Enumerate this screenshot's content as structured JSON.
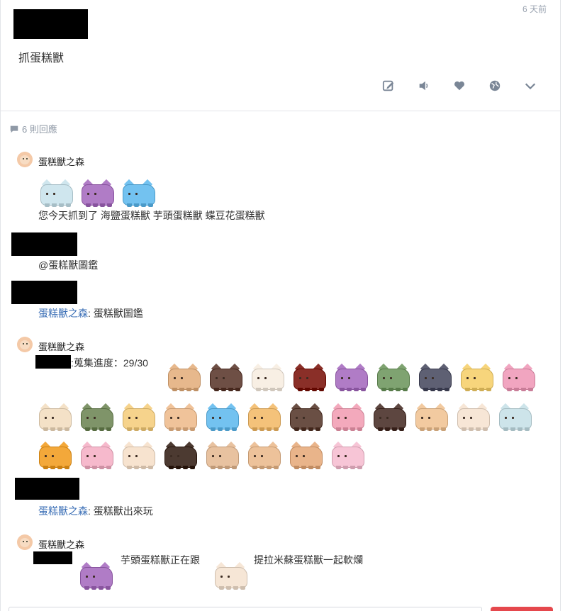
{
  "post": {
    "time": "6 天前",
    "text": "抓蛋糕獸"
  },
  "actions": [
    {
      "name": "edit-icon"
    },
    {
      "name": "speaker-icon"
    },
    {
      "name": "heart-icon"
    },
    {
      "name": "globe-icon"
    },
    {
      "name": "chevron-down-icon"
    }
  ],
  "reply_count": "6 則回應",
  "comments": {
    "c1": {
      "user": "蛋糕獸之森",
      "text": "您今天抓到了 海鹽蛋糕獸 芋頭蛋糕獸 蝶豆花蛋糕獸"
    },
    "c2": {
      "text": "@蛋糕獸圖鑑"
    },
    "c3": {
      "link": "蛋糕獸之森",
      "text": ": 蛋糕獸圖鑑"
    },
    "c4": {
      "user": "蛋糕獸之森",
      "text": ":蒐集進度：29/30"
    },
    "c5": {
      "link": "蛋糕獸之森",
      "text": ": 蛋糕獸出來玩"
    },
    "c6": {
      "user": "蛋糕獸之森",
      "text_a": "芋頭蛋糕獸正在跟",
      "text_b": "提拉米蘇蛋糕獸一起軟爛"
    }
  },
  "colors": {
    "sea_salt": "#cfe6ee",
    "taro": "#b07cc6",
    "butterfly_pea": "#73c2f0",
    "link": "#3b6fb6",
    "accent_red": "#e5484d"
  },
  "monsters": {
    "caught": [
      "#cfe6ee",
      "#b07cc6",
      "#73c2f0"
    ],
    "collection_row1": [
      "#e7b88c",
      "#6e4f45",
      "#f8efe4",
      "#8a2f28",
      "#b07cc6",
      "#7fa371",
      "#5e6073",
      "#f7d57c",
      "#f1a5c0"
    ],
    "collection_row2": [
      "#f4e1c7",
      "#7f9469",
      "#f6d38c",
      "#f0c39a",
      "#73c2f0",
      "#f4c27a",
      "#6a4f44",
      "#f3a9bc",
      "#5d4640",
      "#f2caa0",
      "#f7e6d6",
      "#cde4ea"
    ],
    "collection_row3": [
      "#f3a83a",
      "#f6b9cc",
      "#f7e3cf",
      "#4c3a31",
      "#e8c2a0",
      "#edc29a",
      "#e9b48a",
      "#f7c5d6"
    ],
    "play": [
      "#b07cc6",
      "#f6e6d6"
    ]
  }
}
